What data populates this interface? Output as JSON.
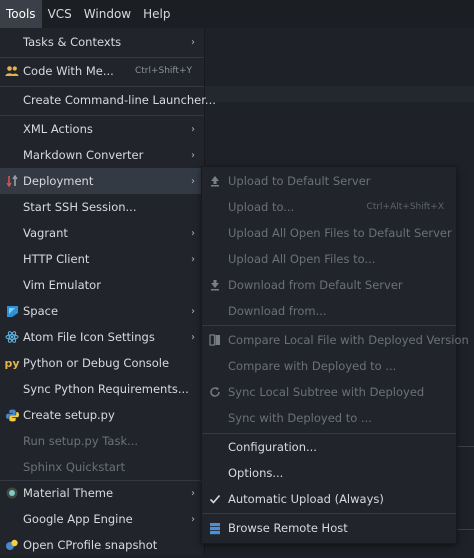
{
  "menubar": {
    "items": [
      {
        "label": "Tools",
        "active": true
      },
      {
        "label": "VCS",
        "active": false
      },
      {
        "label": "Window",
        "active": false
      },
      {
        "label": "Help",
        "active": false
      }
    ]
  },
  "tools_menu": {
    "items": [
      {
        "label": "Tasks & Contexts",
        "submenu": true
      },
      {
        "label": "Code With Me...",
        "shortcut": "Ctrl+Shift+Y",
        "icon": "people-icon"
      },
      {
        "label": "Create Command-line Launcher..."
      },
      {
        "label": "XML Actions",
        "submenu": true
      },
      {
        "label": "Markdown Converter",
        "submenu": true
      },
      {
        "label": "Deployment",
        "submenu": true,
        "icon": "deployment-icon",
        "selected": true
      },
      {
        "label": "Start SSH Session..."
      },
      {
        "label": "Vagrant",
        "submenu": true
      },
      {
        "label": "HTTP Client",
        "submenu": true
      },
      {
        "label": "Vim Emulator"
      },
      {
        "label": "Space",
        "submenu": true,
        "icon": "space-icon"
      },
      {
        "label": "Atom File Icon Settings",
        "submenu": true,
        "icon": "atom-icon"
      },
      {
        "label": "Python or Debug Console",
        "icon": "python-console-icon"
      },
      {
        "label": "Sync Python Requirements..."
      },
      {
        "label": "Create setup.py",
        "icon": "python-icon"
      },
      {
        "label": "Run setup.py Task...",
        "disabled": true
      },
      {
        "label": "Sphinx Quickstart",
        "disabled": true
      },
      {
        "label": "Material Theme",
        "submenu": true,
        "icon": "material-theme-icon"
      },
      {
        "label": "Google App Engine",
        "submenu": true
      },
      {
        "label": "Open CProfile snapshot",
        "icon": "cprofile-icon"
      }
    ]
  },
  "deployment_submenu": {
    "items": [
      {
        "label": "Upload to Default Server",
        "icon": "upload-icon",
        "disabled": true
      },
      {
        "label": "Upload to...",
        "shortcut": "Ctrl+Alt+Shift+X",
        "disabled": true
      },
      {
        "label": "Upload All Open Files to Default Server",
        "disabled": true
      },
      {
        "label": "Upload All Open Files to...",
        "disabled": true
      },
      {
        "label": "Download from Default Server",
        "icon": "download-icon",
        "disabled": true
      },
      {
        "label": "Download from...",
        "disabled": true
      },
      {
        "label": "Compare Local File with Deployed Version",
        "icon": "compare-icon",
        "disabled": true
      },
      {
        "label": "Compare with Deployed to ...",
        "disabled": true
      },
      {
        "label": "Sync Local Subtree with Deployed",
        "icon": "sync-icon",
        "disabled": true
      },
      {
        "label": "Sync with Deployed to ...",
        "disabled": true
      },
      {
        "label": "Configuration..."
      },
      {
        "label": "Options..."
      },
      {
        "label": "Automatic Upload (Always)",
        "icon": "check-icon"
      },
      {
        "label": "Browse Remote Host",
        "icon": "remote-host-icon"
      }
    ]
  },
  "colors": {
    "menu_bg": "#21252b",
    "selected_row": "#343a44",
    "disabled_text": "#6b7079",
    "text": "#d7dadf"
  }
}
